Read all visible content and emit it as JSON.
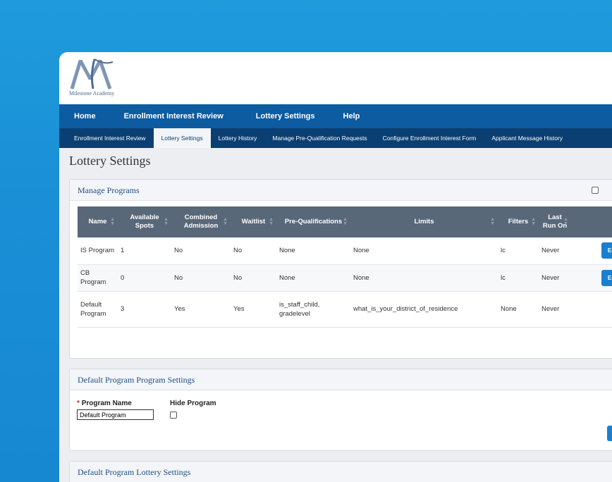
{
  "brand": {
    "name": "Milestone Academy"
  },
  "main_nav": [
    "Home",
    "Enrollment Interest Review",
    "Lottery Settings",
    "Help"
  ],
  "sub_nav": {
    "items": [
      "Enrollment Interest Review",
      "Lottery Settings",
      "Lottery History",
      "Manage Pre-Qualification Requests",
      "Configure Enrollment Interest Form",
      "Applicant Message History"
    ],
    "active_index": 1
  },
  "page_title": "Lottery Settings",
  "manage_programs": {
    "title": "Manage Programs",
    "columns": [
      "Name",
      "Available Spots",
      "Combined Admission",
      "Waitlist",
      "Pre-Qualifications",
      "Limits",
      "Filters",
      "Last Run On"
    ],
    "rows": [
      {
        "name": "IS Program",
        "spots": "1",
        "combined": "No",
        "waitlist": "No",
        "prequal": "None",
        "limits": "None",
        "filters": "lc",
        "last_run": "Never",
        "action": "Edit"
      },
      {
        "name": "CB Program",
        "spots": "0",
        "combined": "No",
        "waitlist": "No",
        "prequal": "None",
        "limits": "None",
        "filters": "lc",
        "last_run": "Never",
        "action": "Edit"
      },
      {
        "name": "Default Program",
        "spots": "3",
        "combined": "Yes",
        "waitlist": "Yes",
        "prequal": "is_staff_child, gradelevel",
        "limits": "what_is_your_district_of_residence",
        "filters": "None",
        "last_run": "Never",
        "action": ""
      }
    ]
  },
  "program_settings": {
    "title": "Default Program Program Settings",
    "required_mark": "*",
    "program_name_label": "Program Name",
    "program_name_value": "Default Program",
    "hide_program_label": "Hide Program"
  },
  "lottery_settings": {
    "title": "Default Program Lottery Settings"
  }
}
